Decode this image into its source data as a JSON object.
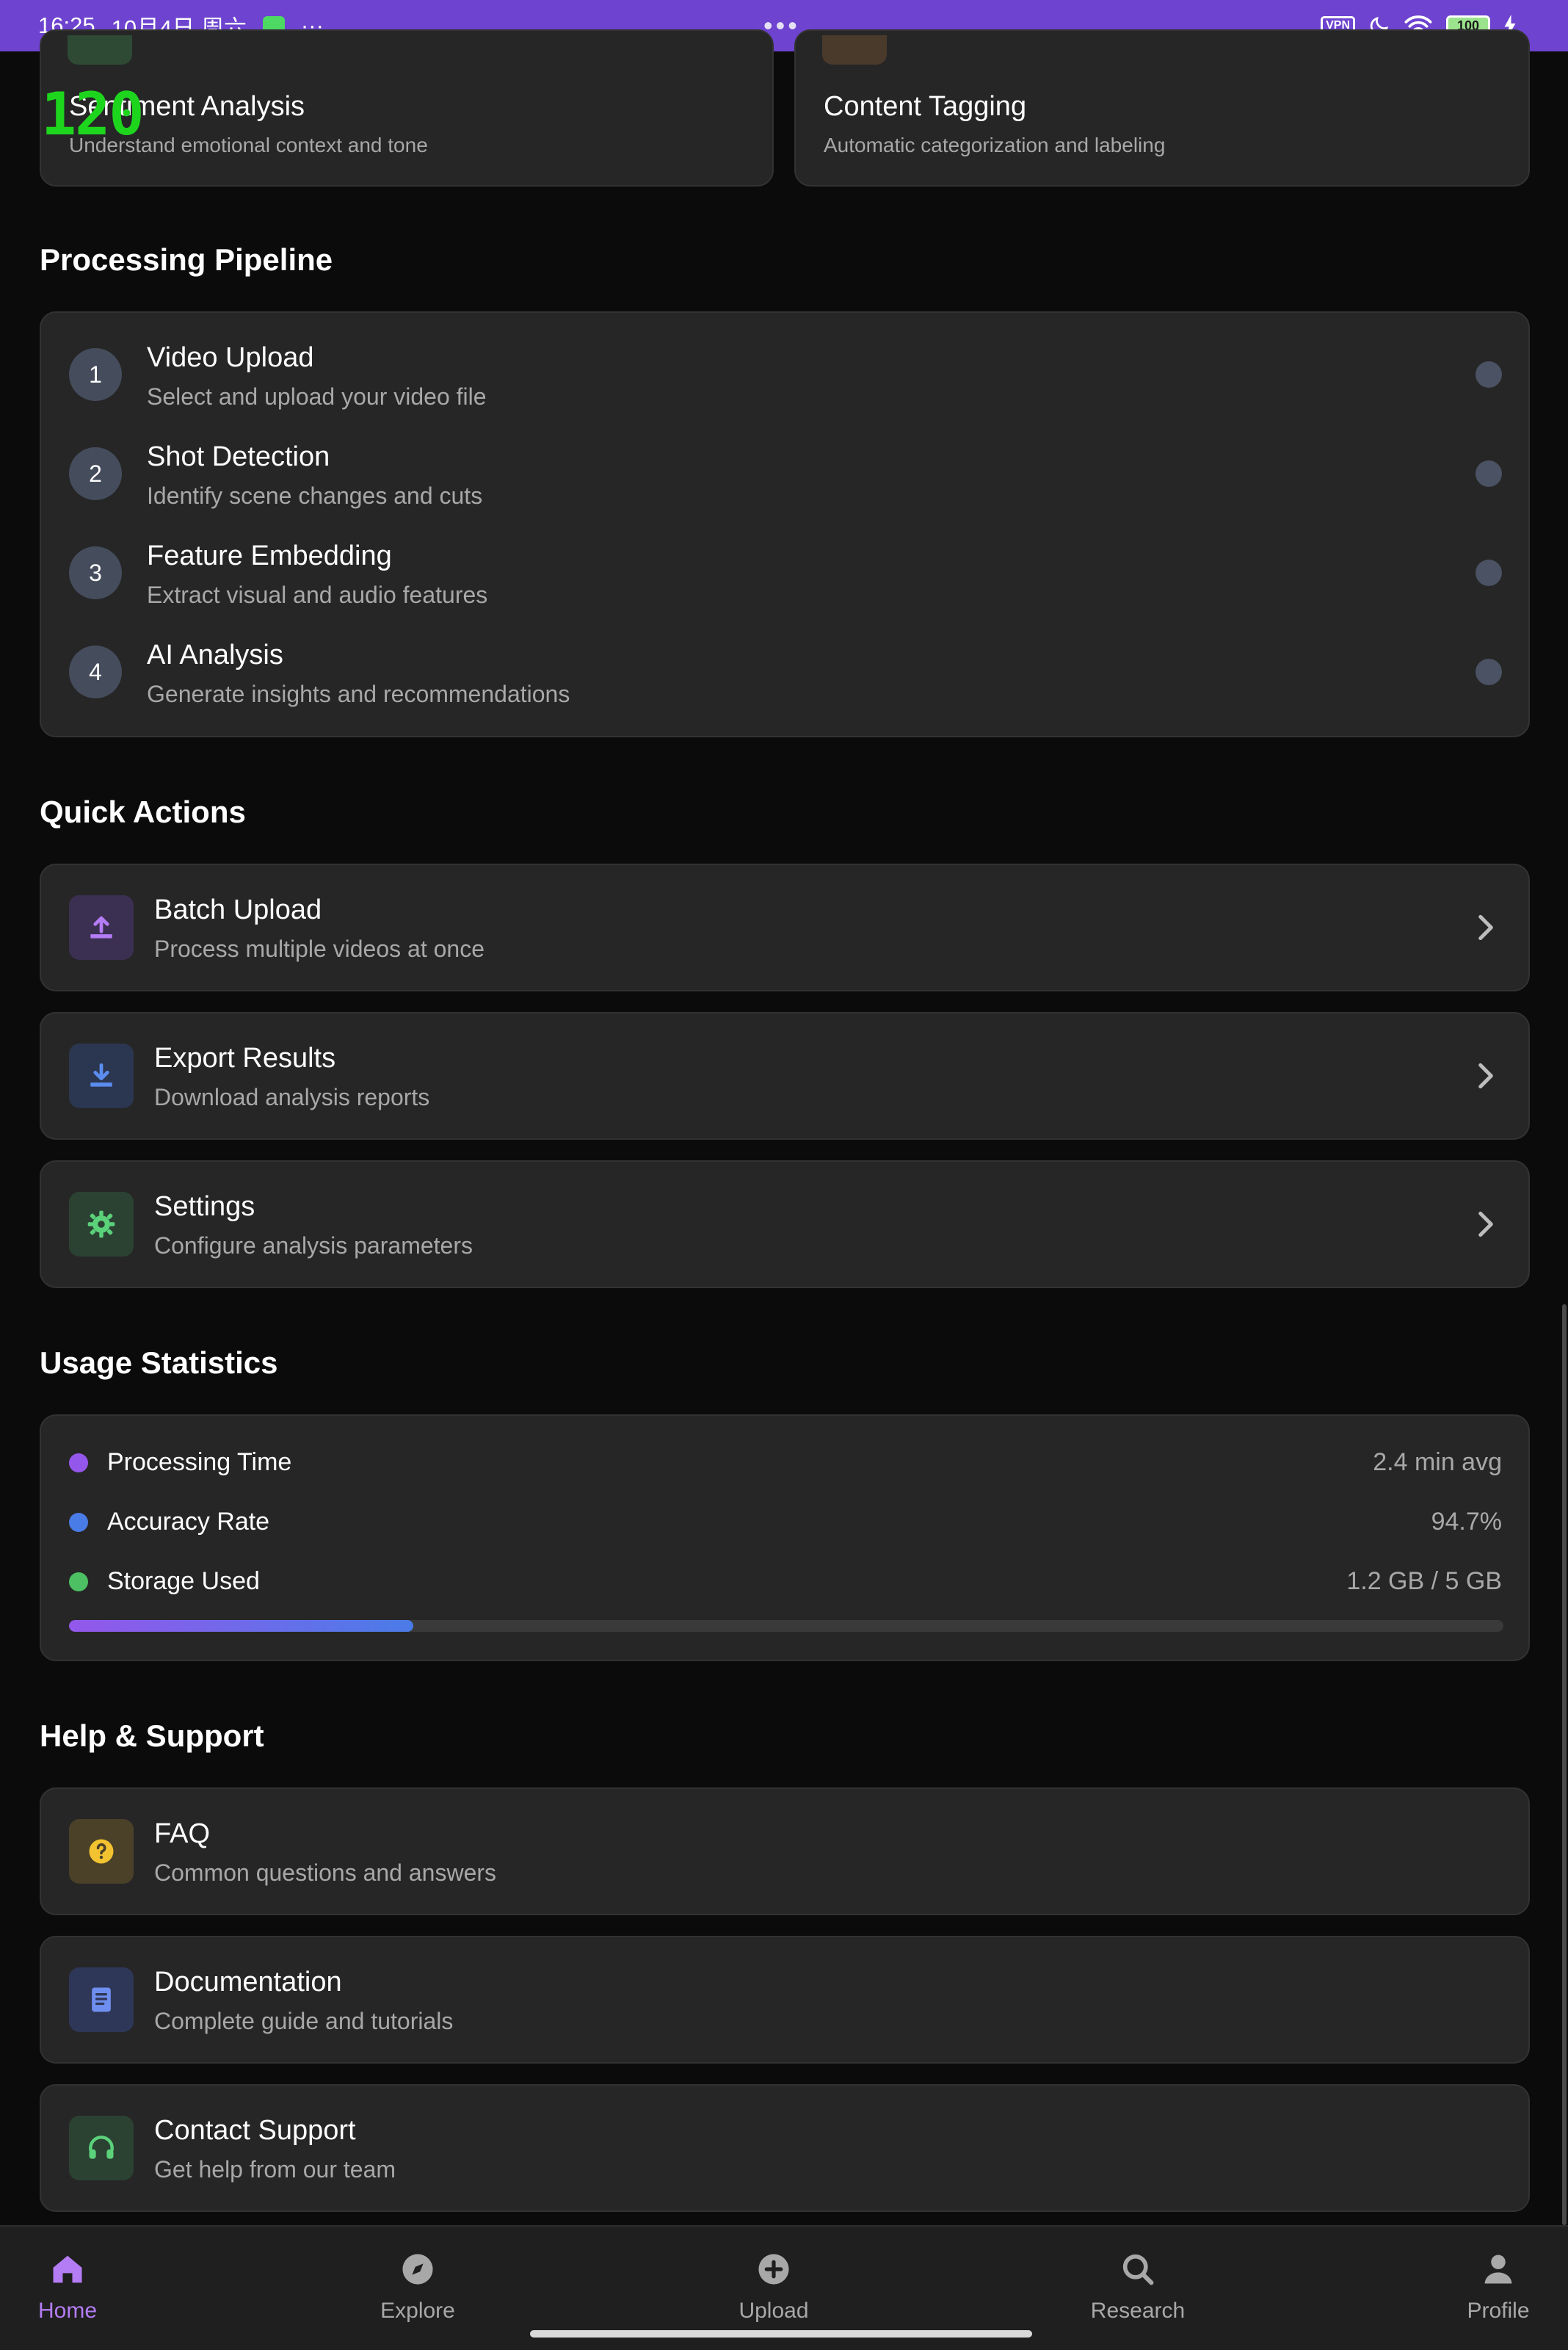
{
  "status_bar": {
    "time": "16:25",
    "date": "10月4日 周六",
    "more": "···",
    "center_dots": "•••",
    "vpn": "VPN",
    "battery": "100"
  },
  "overlay": {
    "fps": "120"
  },
  "feature_cards": [
    {
      "title": "Sentiment Analysis",
      "desc": "Understand emotional context and tone",
      "icon_color": "#2e4a35"
    },
    {
      "title": "Content Tagging",
      "desc": "Automatic categorization and labeling",
      "icon_color": "#4a3a2c"
    }
  ],
  "pipeline": {
    "title": "Processing Pipeline",
    "steps": [
      {
        "num": "1",
        "title": "Video Upload",
        "desc": "Select and upload your video file"
      },
      {
        "num": "2",
        "title": "Shot Detection",
        "desc": "Identify scene changes and cuts"
      },
      {
        "num": "3",
        "title": "Feature Embedding",
        "desc": "Extract visual and audio features"
      },
      {
        "num": "4",
        "title": "AI Analysis",
        "desc": "Generate insights and recommendations"
      }
    ]
  },
  "quick_actions": {
    "title": "Quick Actions",
    "items": [
      {
        "title": "Batch Upload",
        "desc": "Process multiple videos at once",
        "icon": "upload-icon",
        "icon_bg": "#3b2f52",
        "icon_color": "#b47cf5"
      },
      {
        "title": "Export Results",
        "desc": "Download analysis reports",
        "icon": "download-icon",
        "icon_bg": "#2b3650",
        "icon_color": "#5b8def"
      },
      {
        "title": "Settings",
        "desc": "Configure analysis parameters",
        "icon": "gear-icon",
        "icon_bg": "#2b4233",
        "icon_color": "#5bd17a"
      }
    ]
  },
  "usage": {
    "title": "Usage Statistics",
    "rows": [
      {
        "label": "Processing Time",
        "value": "2.4 min avg",
        "color": "#9457ec"
      },
      {
        "label": "Accuracy Rate",
        "value": "94.7%",
        "color": "#4a7ce8"
      },
      {
        "label": "Storage Used",
        "value": "1.2 GB / 5 GB",
        "color": "#4cc063"
      }
    ],
    "storage_fraction": 0.24
  },
  "help": {
    "title": "Help & Support",
    "items": [
      {
        "title": "FAQ",
        "desc": "Common questions and answers",
        "icon": "question-icon",
        "icon_bg": "#4a4128",
        "icon_color": "#f2c230"
      },
      {
        "title": "Documentation",
        "desc": "Complete guide and tutorials",
        "icon": "book-icon",
        "icon_bg": "#2e3757",
        "icon_color": "#6f8ff0"
      },
      {
        "title": "Contact Support",
        "desc": "Get help from our team",
        "icon": "headset-icon",
        "icon_bg": "#2b4233",
        "icon_color": "#5bd17a"
      }
    ]
  },
  "nav": {
    "items": [
      {
        "label": "Home",
        "icon": "home-icon",
        "active": true
      },
      {
        "label": "Explore",
        "icon": "compass-icon",
        "active": false
      },
      {
        "label": "Upload",
        "icon": "plus-circle-icon",
        "active": false
      },
      {
        "label": "Research",
        "icon": "search-icon",
        "active": false
      },
      {
        "label": "Profile",
        "icon": "person-icon",
        "active": false
      }
    ],
    "active_color": "#b47cf5",
    "inactive_color": "#a8a8a8"
  }
}
